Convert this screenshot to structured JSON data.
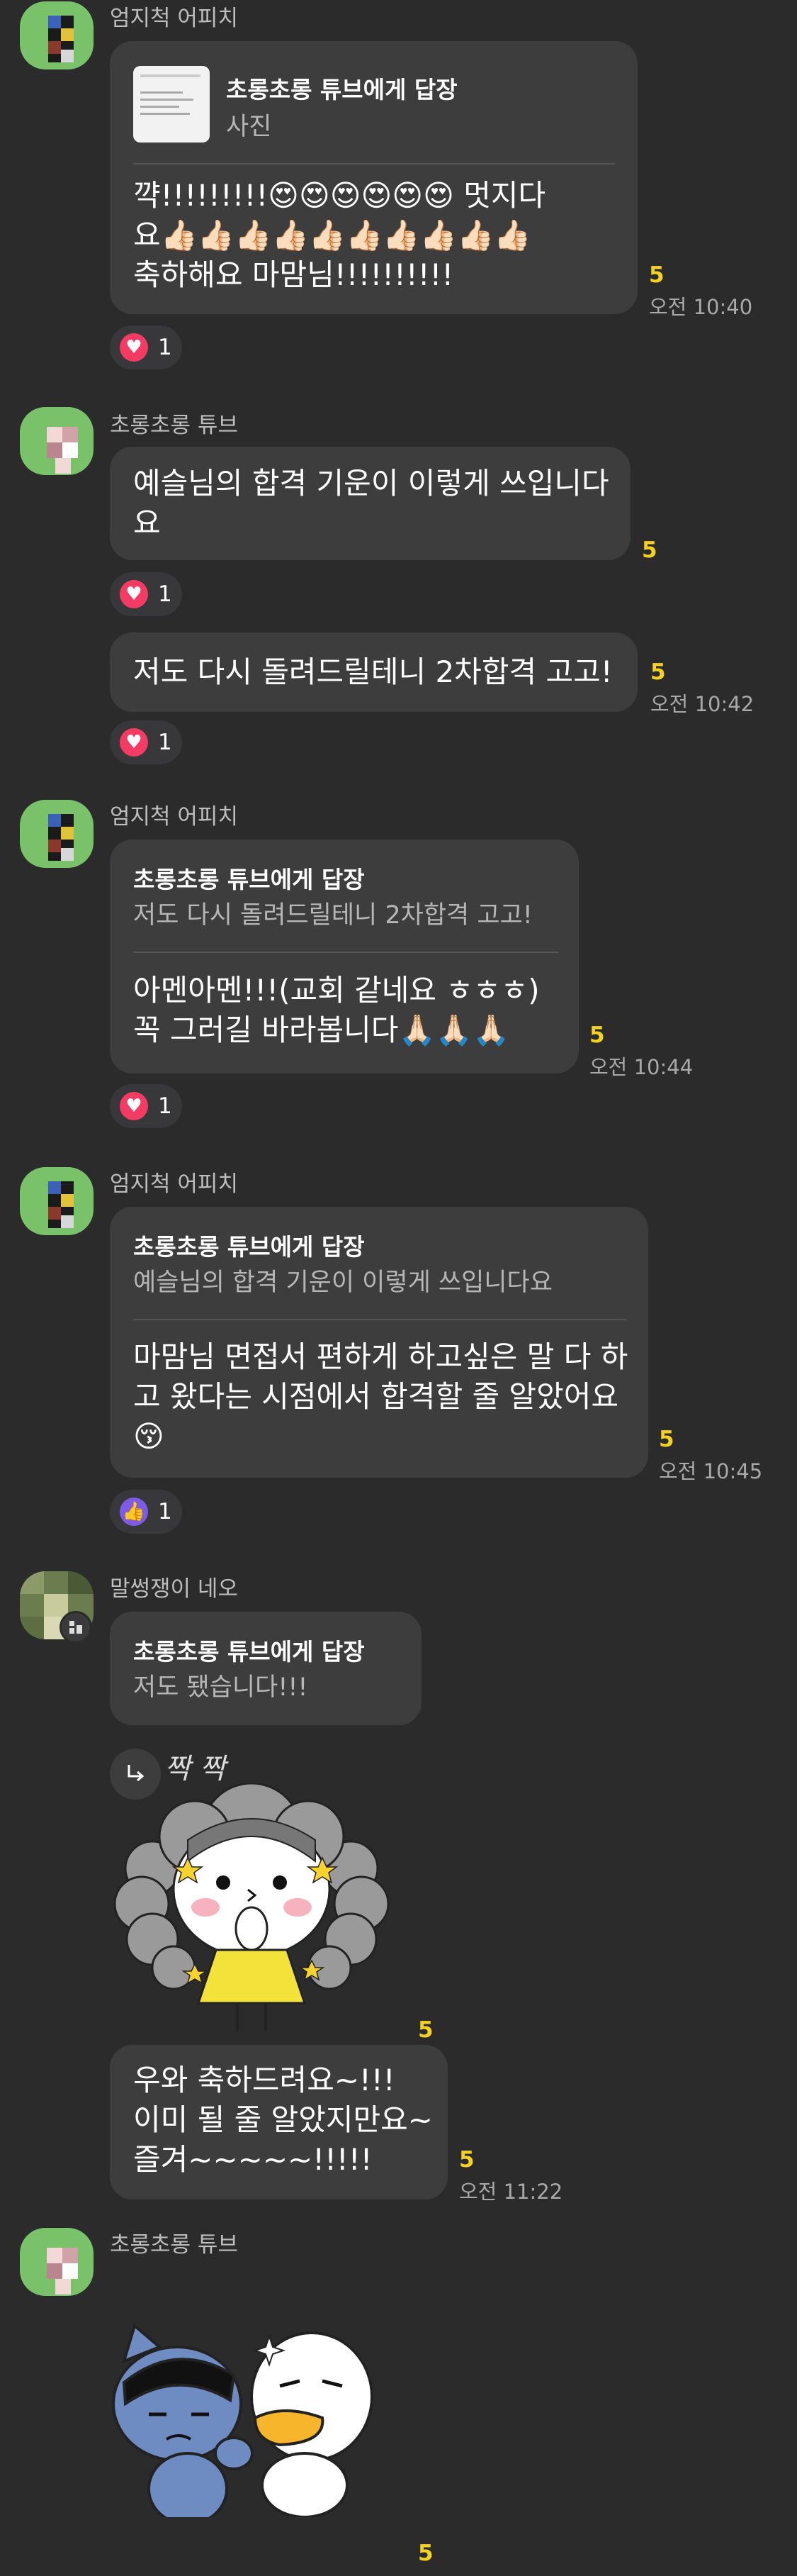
{
  "colors": {
    "background": "#2b2b2c",
    "bubble": "#3d3d3e",
    "unread": "#f5d21f",
    "heart": "#f33b64",
    "thumb": "#7c5be6"
  },
  "msg1": {
    "sender": "엄지척 어피치",
    "reply_title": "초롱초롱 튜브에게 답장",
    "reply_quote": "사진",
    "text": "꺅!!!!!!!!!😍😍😍😍😍😍 멋지다\n요👍🏻👍🏻👍🏻👍🏻👍🏻👍🏻👍🏻👍🏻👍🏻👍🏻\n축하해요 마맘님!!!!!!!!!!",
    "unread": "5",
    "time": "오전 10:40",
    "reaction_count": "1"
  },
  "msg2": {
    "sender": "초롱초롱 튜브",
    "text": "예슬님의 합격 기운이 이렇게 쓰입니다\n요",
    "unread": "5",
    "reaction_count": "1"
  },
  "msg3": {
    "text": "저도 다시 돌려드릴테니 2차합격  고고!",
    "unread": "5",
    "time": "오전 10:42",
    "reaction_count": "1"
  },
  "msg4": {
    "sender": "엄지척 어피치",
    "reply_title": "초롱초롱 튜브에게 답장",
    "reply_quote": "저도 다시 돌려드릴테니 2차합격  고고!",
    "text": "아멘아멘!!!(교회 같네요 ㅎㅎㅎ)\n꼭 그러길 바라봅니다🙏🏻🙏🏻🙏🏻",
    "unread": "5",
    "time": "오전 10:44",
    "reaction_count": "1"
  },
  "msg5": {
    "sender": "엄지척 어피치",
    "reply_title": "초롱초롱 튜브에게 답장",
    "reply_quote": "예슬님의 합격 기운이 이렇게 쓰입니다요",
    "text": "마맘님 면접서 편하게 하고싶은 말 다 하\n고 왔다는 시점에서 합격할 줄 알았어요\n😚",
    "unread": "5",
    "time": "오전 10:45",
    "reaction_count": "1"
  },
  "msg6": {
    "sender": "말썽쟁이 네오",
    "reply_title": "초롱초롱 튜브에게 답장",
    "reply_quote": "저도 됐습니다!!!",
    "sticker_caption": "짝 짝",
    "sticker_unread": "5",
    "text": "우와 축하드려요~!!!\n이미 될 줄 알았지만요~\n즐겨~~~~~!!!!!",
    "unread": "5",
    "time": "오전 11:22"
  },
  "msg7": {
    "sender": "초롱초롱 튜브",
    "unread": "5"
  },
  "icons": {
    "reply": "reply-arrow-icon",
    "heart": "heart-icon",
    "thumb": "thumbs-up-icon"
  }
}
